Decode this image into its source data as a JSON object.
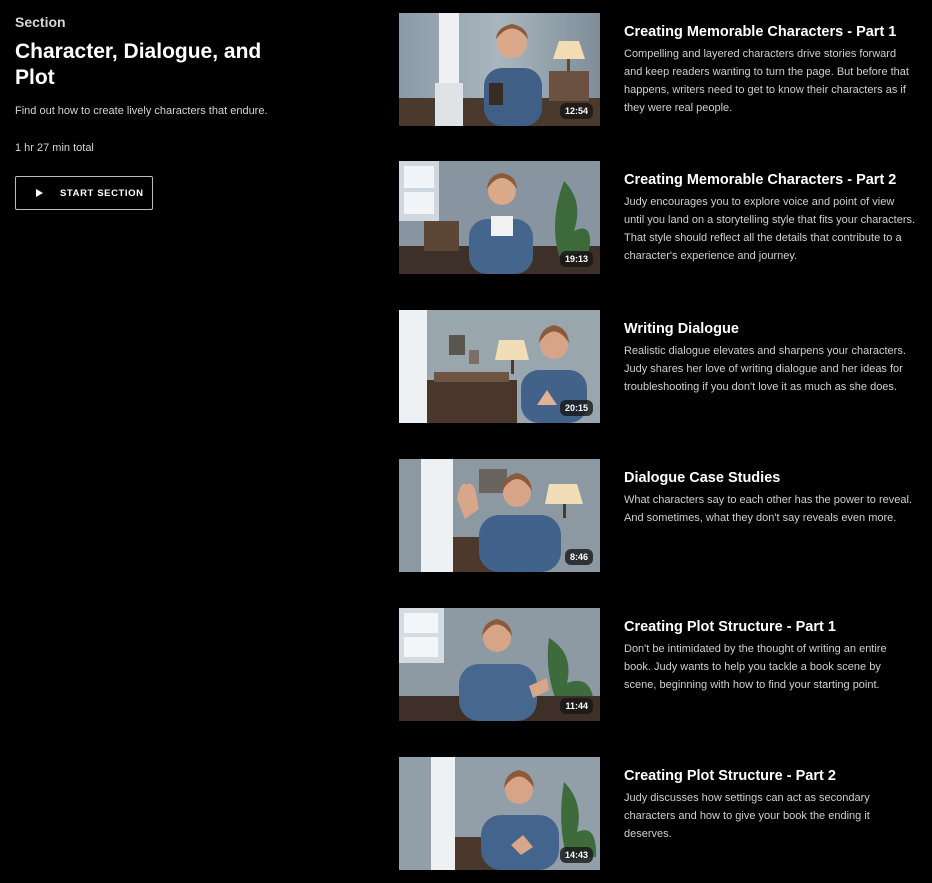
{
  "section": {
    "eyebrow": "Section",
    "title": "Character, Dialogue, and Plot",
    "description": "Find out how to create lively characters that endure.",
    "total": "1 hr 27 min total",
    "start_label": "START SECTION"
  },
  "lessons": [
    {
      "title": "Creating Memorable Characters - Part 1",
      "description": "Compelling and layered characters drive stories forward and keep readers wanting to turn the page. But before that happens, writers need to get to know their characters as if they were real people.",
      "duration": "12:54"
    },
    {
      "title": "Creating Memorable Characters - Part 2",
      "description": "Judy encourages you to explore voice and point of view until you land on a storytelling style that fits your characters. That style should reflect all the details that contribute to a character's experience and journey.",
      "duration": "19:13"
    },
    {
      "title": "Writing Dialogue",
      "description": "Realistic dialogue elevates and sharpens your characters. Judy shares her love of writing dialogue and her ideas for troubleshooting if you don't love it as much as she does.",
      "duration": "20:15"
    },
    {
      "title": "Dialogue Case Studies",
      "description": "What characters say to each other has the power to reveal. And sometimes, what they don't say reveals even more.",
      "duration": "8:46"
    },
    {
      "title": "Creating Plot Structure - Part 1",
      "description": "Don't be intimidated by the thought of writing an entire book. Judy wants to help you tackle a book scene by scene, beginning with how to find your starting point.",
      "duration": "11:44"
    },
    {
      "title": "Creating Plot Structure - Part 2",
      "description": "Judy discusses how settings can act as secondary characters and how to give your book the ending it deserves.",
      "duration": "14:43"
    }
  ]
}
